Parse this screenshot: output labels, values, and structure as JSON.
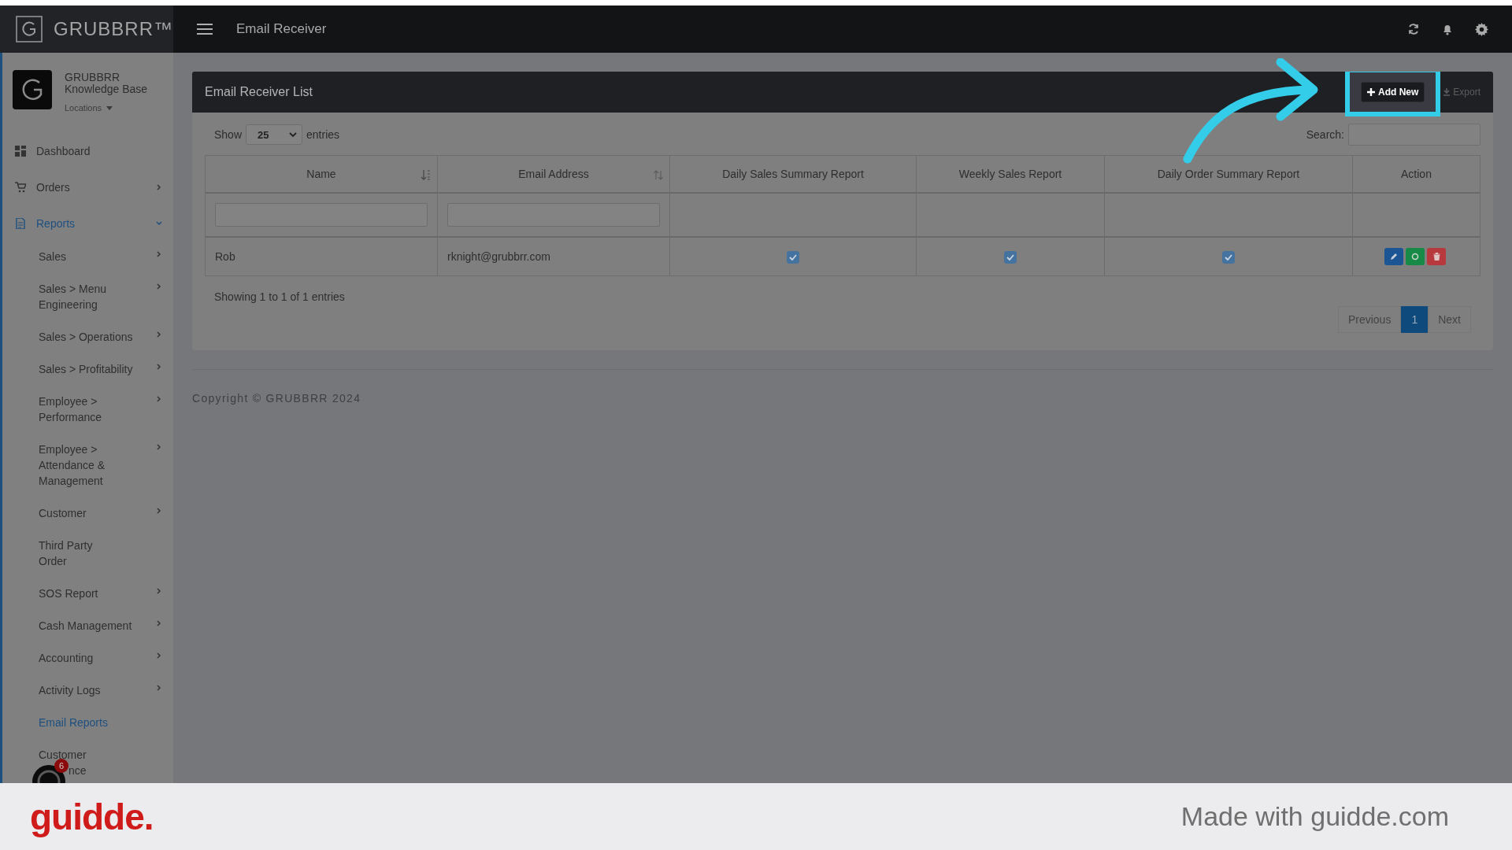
{
  "top_bar": {
    "brand": "GRUBBRR™",
    "title": "Email Receiver"
  },
  "profile": {
    "name": "GRUBBRR Knowledge Base",
    "location_menu": "Locations"
  },
  "sidebar": {
    "items": [
      {
        "label": "Dashboard",
        "has_arrow": false,
        "selected": false
      },
      {
        "label": "Orders",
        "has_arrow": true,
        "expanded": false,
        "selected": false
      },
      {
        "label": "Reports",
        "has_arrow": true,
        "expanded": true,
        "selected": true,
        "children": [
          {
            "label": "Sales",
            "has_arrow": true,
            "selected": false
          },
          {
            "label": "Sales > Menu Engineering",
            "has_arrow": true,
            "selected": false
          },
          {
            "label": "Sales > Operations",
            "has_arrow": true,
            "selected": false
          },
          {
            "label": "Sales > Profitability",
            "has_arrow": true,
            "selected": false
          },
          {
            "label": "Employee > Performance",
            "has_arrow": true,
            "selected": false
          },
          {
            "label": "Employee > Attendance & Management",
            "has_arrow": true,
            "selected": false
          },
          {
            "label": "Customer",
            "has_arrow": true,
            "selected": false
          },
          {
            "label": "Third Party\nOrder",
            "has_arrow": false,
            "selected": false
          },
          {
            "label": "SOS Report",
            "has_arrow": true,
            "selected": false
          },
          {
            "label": "Cash Management",
            "has_arrow": true,
            "selected": false
          },
          {
            "label": "Accounting",
            "has_arrow": true,
            "selected": false
          },
          {
            "label": "Activity Logs",
            "has_arrow": true,
            "selected": false
          },
          {
            "label": "Email Reports",
            "has_arrow": false,
            "selected": true
          },
          {
            "label": "Customer",
            "label_cut": "nce",
            "selected": false
          }
        ]
      }
    ]
  },
  "chat_badge": "6",
  "panel": {
    "title": "Email Receiver List",
    "buttons": [
      {
        "label": "Add New",
        "highlighted": true
      },
      {
        "label": "Export",
        "highlighted": false
      }
    ],
    "length": {
      "before": "Show",
      "value": "25",
      "after": "entries"
    },
    "search_label": "Search:",
    "table": {
      "columns": [
        {
          "label": "Name",
          "sortable": true,
          "sorted": true,
          "filter": true
        },
        {
          "label": "Email Address",
          "sortable": true,
          "sorted": false,
          "filter": true
        },
        {
          "label": "Daily Sales Summary Report",
          "sortable": false,
          "filter": false
        },
        {
          "label": "Weekly Sales Report",
          "sortable": false,
          "filter": false
        },
        {
          "label": "Daily Order Summary Report",
          "sortable": false,
          "filter": false
        },
        {
          "label": "Action",
          "sortable": false,
          "filter": false
        }
      ],
      "rows": [
        {
          "cells": [
            {
              "kind": "text",
              "text": "Rob"
            },
            {
              "kind": "text",
              "text": "rknight@grubbrr.com"
            },
            {
              "kind": "check",
              "checked": true
            },
            {
              "kind": "check",
              "checked": true
            },
            {
              "kind": "check",
              "checked": true
            },
            {
              "kind": "actions"
            }
          ]
        }
      ]
    },
    "info": "Showing 1 to 1 of 1 entries",
    "pagination": [
      {
        "label": "Previous",
        "selected": false
      },
      {
        "label": "1",
        "selected": true
      },
      {
        "label": "Next",
        "selected": false
      }
    ]
  },
  "copyright": "Copyright © GRUBBRR 2024",
  "capture_footer": {
    "brand": "guidde.",
    "caption": "Made with guidde.com"
  }
}
